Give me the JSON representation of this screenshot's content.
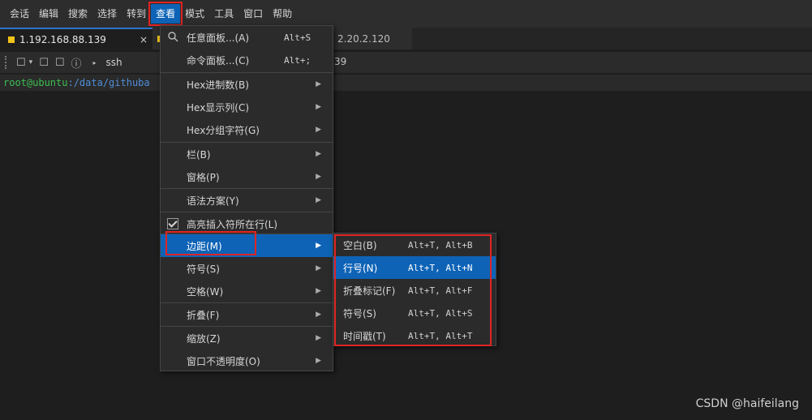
{
  "menubar": {
    "items": [
      "会话",
      "编辑",
      "搜索",
      "选择",
      "转到",
      "查看",
      "模式",
      "工具",
      "窗口",
      "帮助"
    ],
    "active_index": 5
  },
  "tabs": [
    {
      "title": "1.192.168.88.139",
      "close": "×"
    },
    {
      "title": "2.20.2.120"
    }
  ],
  "toolbar": {
    "ssh": "ssh",
    "host_tail": "39"
  },
  "terminal": {
    "user": "root@ubuntu",
    "path": ":/data/githuba"
  },
  "view_menu": {
    "items": [
      {
        "label": "任意面板...(A)",
        "shortcut": "Alt+S",
        "icon": "search-icon"
      },
      {
        "label": "命令面板...(C)",
        "shortcut": "Alt+;"
      },
      {
        "label": "Hex进制数(B)",
        "submenu": true
      },
      {
        "label": "Hex显示列(C)",
        "submenu": true
      },
      {
        "label": "Hex分组字符(G)",
        "submenu": true
      },
      {
        "label": "栏(B)",
        "submenu": true
      },
      {
        "label": "窗格(P)",
        "submenu": true
      },
      {
        "label": "语法方案(Y)",
        "submenu": true
      },
      {
        "label": "高亮插入符所在行(L)",
        "checked": true
      },
      {
        "label": "边距(M)",
        "submenu": true,
        "highlighted": true
      },
      {
        "label": "符号(S)",
        "submenu": true
      },
      {
        "label": "空格(W)",
        "submenu": true
      },
      {
        "label": "折叠(F)",
        "submenu": true
      },
      {
        "label": "缩放(Z)",
        "submenu": true
      },
      {
        "label": "窗口不透明度(O)",
        "submenu": true
      }
    ]
  },
  "margin_submenu": {
    "items": [
      {
        "label": "空白(B)",
        "shortcut": "Alt+T, Alt+B"
      },
      {
        "label": "行号(N)",
        "shortcut": "Alt+T, Alt+N",
        "highlighted": true
      },
      {
        "label": "折叠标记(F)",
        "shortcut": "Alt+T, Alt+F"
      },
      {
        "label": "符号(S)",
        "shortcut": "Alt+T, Alt+S"
      },
      {
        "label": "时间戳(T)",
        "shortcut": "Alt+T, Alt+T"
      }
    ]
  },
  "watermark": "CSDN @haifeilang"
}
